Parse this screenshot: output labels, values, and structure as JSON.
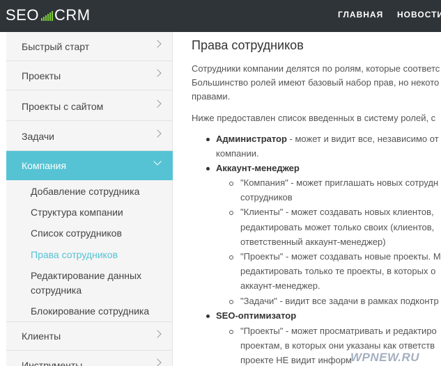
{
  "topbar": {
    "logo_left": "SEO",
    "logo_right": "CRM",
    "nav": [
      "ГЛАВНАЯ",
      "НОВОСТИ"
    ]
  },
  "sidebar": {
    "items": [
      {
        "label": "Быстрый старт"
      },
      {
        "label": "Проекты"
      },
      {
        "label": "Проекты с сайтом"
      },
      {
        "label": "Задачи"
      },
      {
        "label": "Компания",
        "active": true
      },
      {
        "label": "Клиенты"
      },
      {
        "label": "Инструменты"
      }
    ],
    "subitems": [
      "Добавление сотрудника",
      "Структура компании",
      "Список сотрудников",
      "Права сотрудников",
      "Редактирование данных",
      "сотрудника",
      "Блокирование сотрудника"
    ],
    "current_subitem": "Права сотрудников"
  },
  "content": {
    "title": "Права сотрудников",
    "intro": [
      "Сотрудники компании делятся по ролям, которые соответс",
      "Большинство ролей имеют базовый набор прав, но некото",
      "правами."
    ],
    "list_intro": "Ниже предоставлен список введенных в систему ролей, с",
    "roles": [
      {
        "name": "Администратор",
        "text": " - может и видит все, независимо от",
        "cont": "компании."
      },
      {
        "name": "Аккаунт-менеджер",
        "items": [
          [
            "\"Компания\" - может приглашать новых сотрудн",
            "сотрудников"
          ],
          [
            "\"Клиенты\" - может создавать новых клиентов,",
            "редактировать может только своих (клиентов,",
            "ответственный аккаунт-менеджер)"
          ],
          [
            "\"Проекты\" - может создавать новые проекты. М",
            "редактировать только те проекты, в которых о",
            "аккаунт-менеджер."
          ],
          [
            "\"Задачи\" - видит все задачи в рамках подконтр"
          ]
        ]
      },
      {
        "name": "SEO-оптимизатор",
        "items": [
          [
            "\"Проекты\" - может просматривать и редактиро",
            "проектам, в которых они указаны как ответств",
            "проекте НЕ видит информ"
          ]
        ]
      }
    ]
  },
  "watermark": "WPNEW.RU",
  "colors": {
    "topbar": "#2f3439",
    "accent": "#55c3d4",
    "logo_bars": "#7ccd3b"
  }
}
